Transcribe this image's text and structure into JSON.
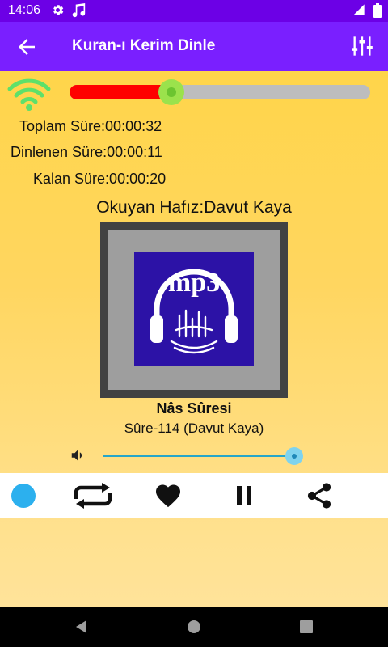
{
  "status_bar": {
    "time": "14:06"
  },
  "toolbar": {
    "title": "Kuran-ı Kerim Dinle"
  },
  "player": {
    "progress_fraction": 0.34,
    "total_label": "Toplam Süre:00:00:32",
    "elapsed_label": "Dinlenen Süre:00:00:11",
    "remaining_label": "Kalan Süre:00:00:20",
    "reciter_label": "Okuyan Hafız:Davut Kaya",
    "logo_text": "mp3",
    "track_title": "Nâs Sûresi",
    "track_subtitle": "Sûre-114 (Davut Kaya)",
    "volume_fraction": 0.96
  },
  "colors": {
    "status_bar": "#6c00e6",
    "toolbar": "#7a1fff",
    "progress_fill": "#ff0000",
    "seek_thumb": "#9be24c",
    "accent_dot": "#2cb0ee"
  },
  "icons": {
    "toolbar": [
      "back-arrow-icon",
      "equalizer-icon"
    ],
    "controls": [
      "status-dot-icon",
      "repeat-icon",
      "favorite-heart-icon",
      "pause-icon",
      "share-icon"
    ],
    "navbar": [
      "nav-back-icon",
      "nav-home-icon",
      "nav-recents-icon"
    ]
  }
}
